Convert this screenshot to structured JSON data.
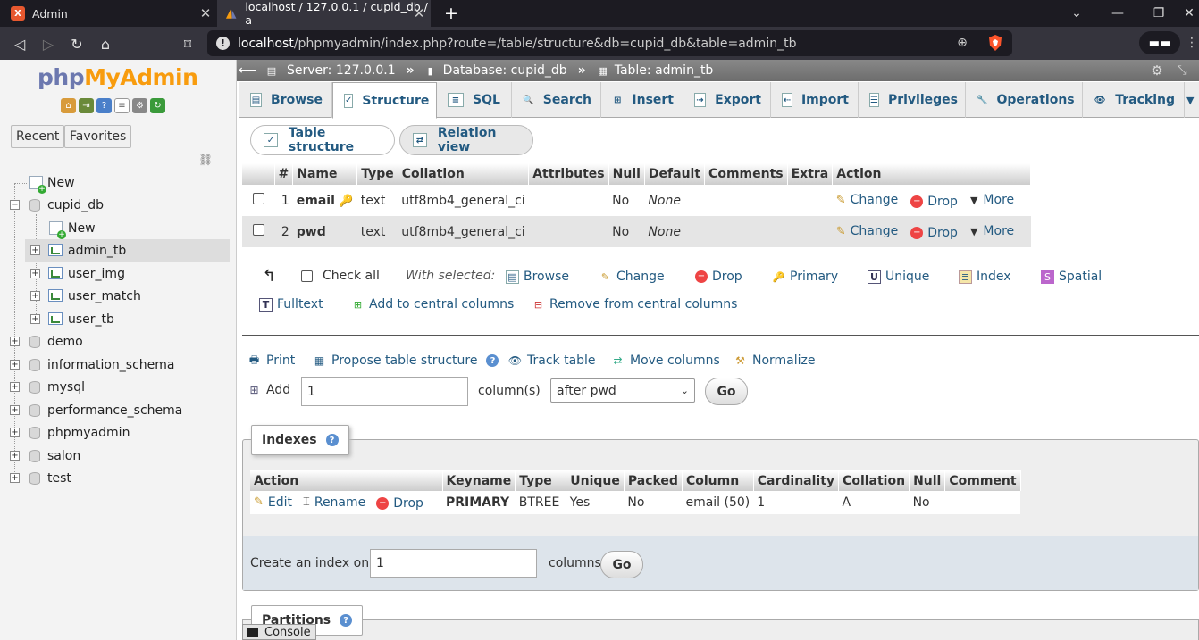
{
  "browser": {
    "tabs": [
      {
        "title": "Admin"
      },
      {
        "title": "localhost / 127.0.0.1 / cupid_db / a"
      }
    ],
    "url_host": "localhost",
    "url_path": "/phpmyadmin/index.php?route=/table/structure&db=cupid_db&table=admin_tb"
  },
  "sidebar": {
    "logo_php": "php",
    "logo_my": "MyAdmin",
    "recent_label": "Recent",
    "favorites_label": "Favorites",
    "tree": {
      "new": "New",
      "cupid_db": "cupid_db",
      "cupid_new": "New",
      "admin_tb": "admin_tb",
      "user_img": "user_img",
      "user_match": "user_match",
      "user_tb": "user_tb",
      "demo": "demo",
      "information_schema": "information_schema",
      "mysql": "mysql",
      "performance_schema": "performance_schema",
      "phpmyadmin": "phpmyadmin",
      "salon": "salon",
      "test": "test"
    }
  },
  "breadcrumb": {
    "server": "Server: 127.0.0.1",
    "database": "Database: cupid_db",
    "table": "Table: admin_tb",
    "sep": "»"
  },
  "menu": {
    "browse": "Browse",
    "structure": "Structure",
    "sql": "SQL",
    "search": "Search",
    "insert": "Insert",
    "export": "Export",
    "import": "Import",
    "privileges": "Privileges",
    "operations": "Operations",
    "tracking": "Tracking"
  },
  "subtabs": {
    "table_structure": "Table structure",
    "relation_view": "Relation view"
  },
  "structure": {
    "headers": [
      "#",
      "Name",
      "Type",
      "Collation",
      "Attributes",
      "Null",
      "Default",
      "Comments",
      "Extra",
      "Action"
    ],
    "rows": [
      {
        "num": "1",
        "name": "email",
        "type": "text",
        "collation": "utf8mb4_general_ci",
        "null": "No",
        "default": "None"
      },
      {
        "num": "2",
        "name": "pwd",
        "type": "text",
        "collation": "utf8mb4_general_ci",
        "null": "No",
        "default": "None"
      }
    ],
    "actions": {
      "change": "Change",
      "drop": "Drop",
      "more": "More"
    }
  },
  "with_selected": {
    "check_all": "Check all",
    "label": "With selected:",
    "browse": "Browse",
    "change": "Change",
    "drop": "Drop",
    "primary": "Primary",
    "unique": "Unique",
    "index": "Index",
    "spatial": "Spatial",
    "fulltext": "Fulltext",
    "add_central": "Add to central columns",
    "remove_central": "Remove from central columns"
  },
  "tools": {
    "print": "Print",
    "propose": "Propose table structure",
    "track": "Track table",
    "move": "Move columns",
    "normalize": "Normalize"
  },
  "add_column": {
    "label": "Add",
    "count": "1",
    "unit": "column(s)",
    "position": "after pwd",
    "go": "Go"
  },
  "indexes": {
    "legend": "Indexes",
    "headers": [
      "Action",
      "Keyname",
      "Type",
      "Unique",
      "Packed",
      "Column",
      "Cardinality",
      "Collation",
      "Null",
      "Comment"
    ],
    "row": {
      "edit": "Edit",
      "rename": "Rename",
      "drop": "Drop",
      "keyname": "PRIMARY",
      "type": "BTREE",
      "unique": "Yes",
      "packed": "No",
      "column": "email (50)",
      "cardinality": "1",
      "collation": "A",
      "null": "No",
      "comment": ""
    },
    "create_label": "Create an index on",
    "create_count": "1",
    "create_unit": "columns",
    "go": "Go"
  },
  "partitions": {
    "legend": "Partitions"
  },
  "console": {
    "label": "Console"
  }
}
